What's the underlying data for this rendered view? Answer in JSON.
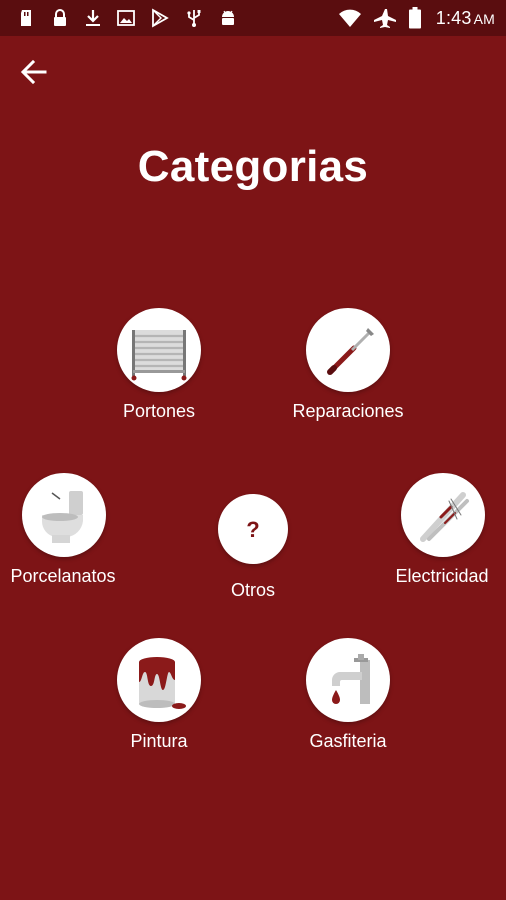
{
  "status_bar": {
    "time": "1:43",
    "ampm": "AM",
    "left_icons": [
      "sd-card-icon",
      "lock-icon",
      "download-icon",
      "image-icon",
      "play-store-icon",
      "usb-icon",
      "android-icon"
    ],
    "right_icons": [
      "wifi-icon",
      "airplane-icon",
      "battery-icon"
    ]
  },
  "header": {
    "back_icon": "arrow-left-icon",
    "title": "Categorias"
  },
  "categories": [
    {
      "label": "Portones",
      "icon": "gate-icon"
    },
    {
      "label": "Reparaciones",
      "icon": "screwdriver-icon"
    },
    {
      "label": "Porcelanatos",
      "icon": "toilet-icon"
    },
    {
      "label": "Otros",
      "icon": "question-icon"
    },
    {
      "label": "Electricidad",
      "icon": "cables-icon"
    },
    {
      "label": "Pintura",
      "icon": "paint-bucket-icon"
    },
    {
      "label": "Gasfiteria",
      "icon": "faucet-icon"
    }
  ],
  "colors": {
    "background": "#7d1416",
    "status_bar": "#5a0d0f",
    "icon_accent": "#8b1a1a",
    "circle": "#ffffff"
  }
}
